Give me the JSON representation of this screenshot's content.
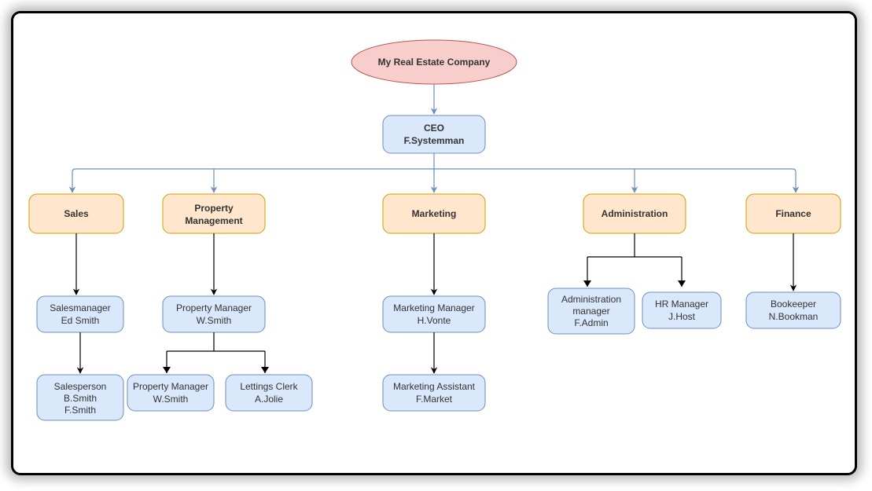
{
  "company": {
    "name": "My Real Estate Company"
  },
  "ceo": {
    "title": "CEO",
    "name": "F.Systemman"
  },
  "departments": {
    "sales": {
      "label": "Sales"
    },
    "property": {
      "label1": "Property",
      "label2": "Management"
    },
    "marketing": {
      "label": "Marketing"
    },
    "admin": {
      "label": "Administration"
    },
    "finance": {
      "label": "Finance"
    }
  },
  "people": {
    "salesManager": {
      "line1": "Salesmanager",
      "line2": "Ed Smith"
    },
    "salesperson": {
      "line1": "Salesperson",
      "line2": "B.Smith",
      "line3": "F.Smith"
    },
    "propManager1": {
      "line1": "Property Manager",
      "line2": "W.Smith"
    },
    "propManager2": {
      "line1": "Property Manager",
      "line2": "W.Smith"
    },
    "lettingsClerk": {
      "line1": "Lettings Clerk",
      "line2": "A.Jolie"
    },
    "mktManager": {
      "line1": "Marketing Manager",
      "line2": "H.Vonte"
    },
    "mktAssistant": {
      "line1": "Marketing Assistant",
      "line2": "F.Market"
    },
    "adminManager": {
      "line1": "Administration",
      "line2": "manager",
      "line3": "F.Admin"
    },
    "hrManager": {
      "line1": "HR Manager",
      "line2": "J.Host"
    },
    "bookkeeper": {
      "line1": "Bookeeper",
      "line2": "N.Bookman"
    }
  },
  "palette": {
    "ellipse": "#f8cecc",
    "blue": "#dae8fc",
    "orange": "#ffe6cc"
  },
  "chart_data": {
    "type": "tree",
    "title": "My Real Estate Company",
    "nodes": [
      {
        "id": "company",
        "label": "My Real Estate Company",
        "shape": "ellipse",
        "color": "#f8cecc"
      },
      {
        "id": "ceo",
        "label": "CEO\nF.Systemman",
        "shape": "rect",
        "color": "#dae8fc"
      },
      {
        "id": "dept-sales",
        "label": "Sales",
        "shape": "rect",
        "color": "#ffe6cc"
      },
      {
        "id": "dept-property",
        "label": "Property\nManagement",
        "shape": "rect",
        "color": "#ffe6cc"
      },
      {
        "id": "dept-marketing",
        "label": "Marketing",
        "shape": "rect",
        "color": "#ffe6cc"
      },
      {
        "id": "dept-admin",
        "label": "Administration",
        "shape": "rect",
        "color": "#ffe6cc"
      },
      {
        "id": "dept-finance",
        "label": "Finance",
        "shape": "rect",
        "color": "#ffe6cc"
      },
      {
        "id": "sales-mgr",
        "label": "Salesmanager\nEd Smith",
        "shape": "rect",
        "color": "#dae8fc"
      },
      {
        "id": "salesperson",
        "label": "Salesperson\nB.Smith\nF.Smith",
        "shape": "rect",
        "color": "#dae8fc"
      },
      {
        "id": "prop-mgr1",
        "label": "Property Manager\nW.Smith",
        "shape": "rect",
        "color": "#dae8fc"
      },
      {
        "id": "prop-mgr2",
        "label": "Property Manager\nW.Smith",
        "shape": "rect",
        "color": "#dae8fc"
      },
      {
        "id": "lettings",
        "label": "Lettings Clerk\nA.Jolie",
        "shape": "rect",
        "color": "#dae8fc"
      },
      {
        "id": "mkt-mgr",
        "label": "Marketing Manager\nH.Vonte",
        "shape": "rect",
        "color": "#dae8fc"
      },
      {
        "id": "mkt-asst",
        "label": "Marketing Assistant\nF.Market",
        "shape": "rect",
        "color": "#dae8fc"
      },
      {
        "id": "admin-mgr",
        "label": "Administration\nmanager\nF.Admin",
        "shape": "rect",
        "color": "#dae8fc"
      },
      {
        "id": "hr-mgr",
        "label": "HR Manager\nJ.Host",
        "shape": "rect",
        "color": "#dae8fc"
      },
      {
        "id": "bookkeeper",
        "label": "Bookeeper\nN.Bookman",
        "shape": "rect",
        "color": "#dae8fc"
      }
    ],
    "edges": [
      [
        "company",
        "ceo"
      ],
      [
        "ceo",
        "dept-sales"
      ],
      [
        "ceo",
        "dept-property"
      ],
      [
        "ceo",
        "dept-marketing"
      ],
      [
        "ceo",
        "dept-admin"
      ],
      [
        "ceo",
        "dept-finance"
      ],
      [
        "dept-sales",
        "sales-mgr"
      ],
      [
        "sales-mgr",
        "salesperson"
      ],
      [
        "dept-property",
        "prop-mgr1"
      ],
      [
        "prop-mgr1",
        "prop-mgr2"
      ],
      [
        "prop-mgr1",
        "lettings"
      ],
      [
        "dept-marketing",
        "mkt-mgr"
      ],
      [
        "mkt-mgr",
        "mkt-asst"
      ],
      [
        "dept-admin",
        "admin-mgr"
      ],
      [
        "dept-admin",
        "hr-mgr"
      ],
      [
        "dept-finance",
        "bookkeeper"
      ]
    ]
  }
}
